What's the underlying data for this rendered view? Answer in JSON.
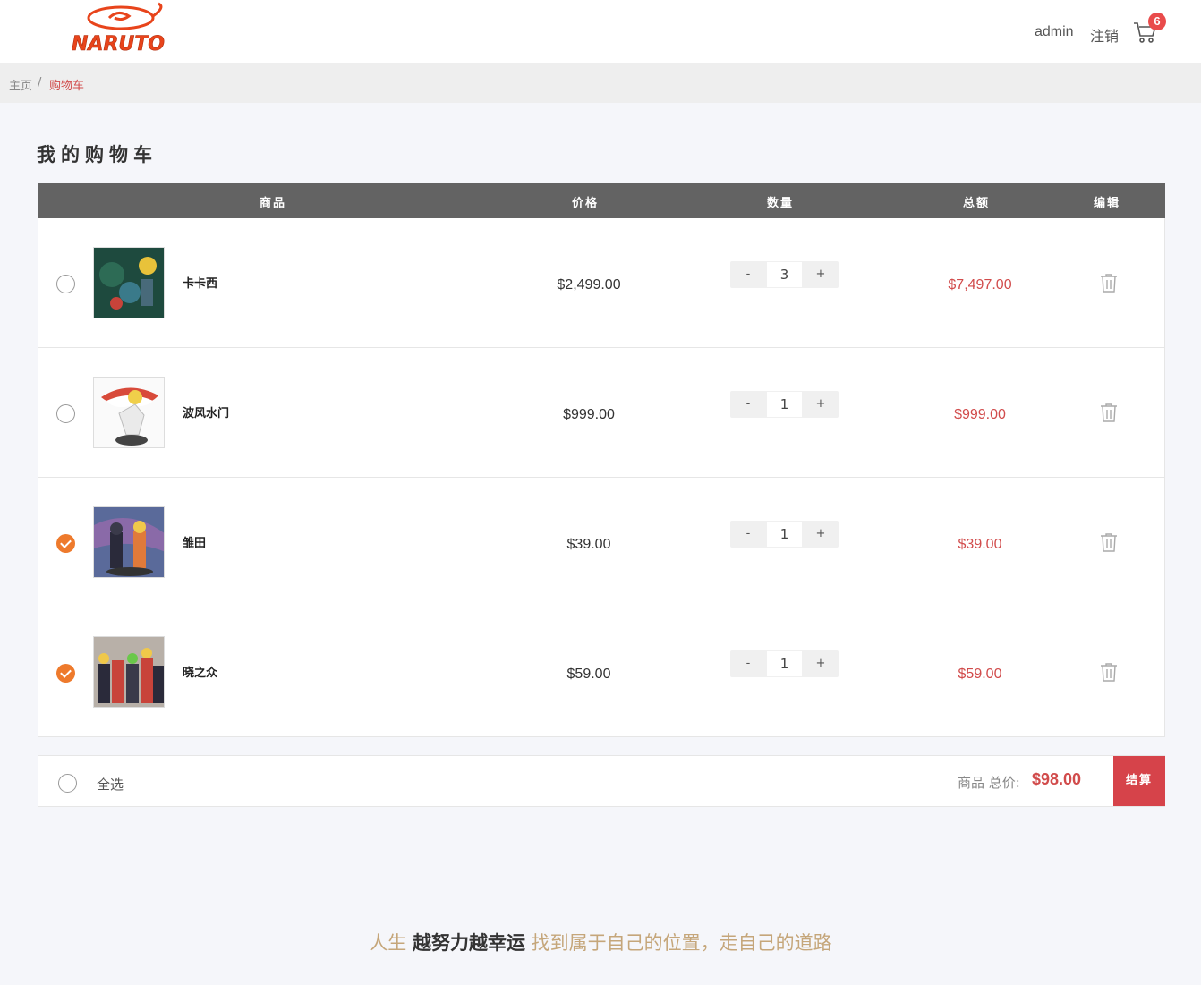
{
  "header": {
    "logo_text": "NARUTO",
    "user": "admin",
    "logout": "注销",
    "cart_count": "6"
  },
  "breadcrumb": {
    "home": "主页",
    "separator": "/",
    "current": "购物车"
  },
  "title": "我的购物车",
  "columns": {
    "product": "商品",
    "price": "价格",
    "quantity": "数量",
    "total": "总额",
    "edit": "编辑"
  },
  "items": [
    {
      "name": "卡卡西",
      "price": "$2,499.00",
      "qty": "3",
      "total": "$7,497.00",
      "checked": false
    },
    {
      "name": "波风水门",
      "price": "$999.00",
      "qty": "1",
      "total": "$999.00",
      "checked": false
    },
    {
      "name": "雏田",
      "price": "$39.00",
      "qty": "1",
      "total": "$39.00",
      "checked": true
    },
    {
      "name": "晓之众",
      "price": "$59.00",
      "qty": "1",
      "total": "$59.00",
      "checked": true
    }
  ],
  "qty_minus": "-",
  "qty_plus": "+",
  "footer_bar": {
    "select_all": "全选",
    "sum_label": "商品 总价:",
    "sum_value": "$98.00",
    "checkout": "结算"
  },
  "slogan": {
    "part1": "人生 ",
    "part2": "越努力越幸运",
    "part3": " 找到属于自己的位置，走自己的道路"
  },
  "colors": {
    "accent": "#d14b4b",
    "checked": "#ee7a2c",
    "header_bg": "#636363"
  }
}
